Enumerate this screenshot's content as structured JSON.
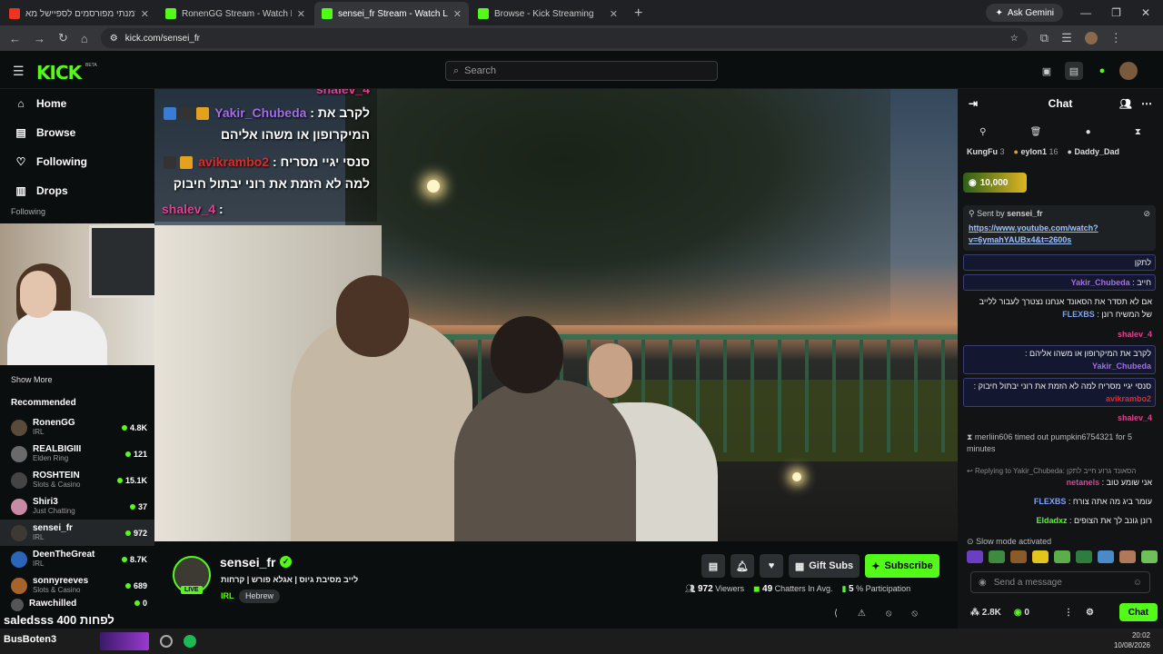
{
  "browser": {
    "tabs": [
      {
        "title": "הזמנתי מפורסמים לספיישל מא",
        "fav_color": "#e32"
      },
      {
        "title": "RonenGG Stream - Watch Live on",
        "fav_color": "#53fc18"
      },
      {
        "title": "sensei_fr Stream - Watch Li",
        "fav_color": "#53fc18"
      },
      {
        "title": "Browse - Kick Streaming",
        "fav_color": "#53fc18"
      }
    ],
    "gemini_label": "Ask Gemini",
    "url": "kick.com/sensei_fr"
  },
  "header": {
    "logo": "KICK",
    "beta": "BETA",
    "search_placeholder": "Search"
  },
  "sidebar": {
    "nav": [
      {
        "label": "Home",
        "icon": "home-icon"
      },
      {
        "label": "Browse",
        "icon": "browse-icon"
      },
      {
        "label": "Following",
        "icon": "heart-icon"
      },
      {
        "label": "Drops",
        "icon": "drops-icon"
      }
    ],
    "following_label": "Following",
    "show_more": "Show More",
    "recommended_title": "Recommended",
    "recommended": [
      {
        "name": "RonenGG",
        "category": "IRL",
        "viewers": "4.8K",
        "color": "#5a4a3a"
      },
      {
        "name": "REALBIGIII",
        "category": "Elden Ring",
        "viewers": "121",
        "color": "#6a6a6a"
      },
      {
        "name": "ROSHTEIN",
        "category": "Slots & Casino",
        "viewers": "15.1K",
        "color": "#444"
      },
      {
        "name": "Shiri3",
        "category": "Just Chatting",
        "viewers": "37",
        "color": "#c98aa5"
      },
      {
        "name": "sensei_fr",
        "category": "IRL",
        "viewers": "972",
        "color": "#3c3a33"
      },
      {
        "name": "DeenTheGreat",
        "category": "IRL",
        "viewers": "8.7K",
        "color": "#2a66b8"
      },
      {
        "name": "sonnyreeves",
        "category": "Slots & Casino",
        "viewers": "689",
        "color": "#a6632a"
      },
      {
        "name": "Rawchilled",
        "category": "",
        "viewers": "0",
        "color": "#555"
      }
    ],
    "big_overlay": "saledsss לפחות 400"
  },
  "video_overlay": {
    "lines": [
      {
        "user": "shalev_4",
        "text": "",
        "cls": "pink"
      },
      {
        "user": "Yakir_Chubeda",
        "text": "לקרב את",
        "cls": ""
      },
      {
        "user": "",
        "text": "המיקרופון או משהו אליהם",
        "cls": ""
      },
      {
        "user": "avikrambo2",
        "text": "סנסי יגיי מסריח",
        "cls": "red"
      },
      {
        "user": "",
        "text": "למה לא הזמת את רוני יבתול חיבוק",
        "cls": ""
      },
      {
        "user": "shalev_4",
        "text": "",
        "cls": "pink"
      }
    ]
  },
  "stream": {
    "channel": "sensei_fr",
    "live": "LIVE",
    "title": "לייב מסיבת גיוס | אגלא פורש | קרחות",
    "category": "IRL",
    "tag": "Hebrew",
    "gift_subs": "Gift Subs",
    "subscribe": "Subscribe",
    "viewers": "972",
    "viewers_label": "Viewers",
    "chatters": "49",
    "chatters_label": "Chatters In Avg.",
    "participation": "5",
    "participation_label": "% Participation"
  },
  "chat": {
    "title": "Chat",
    "gifters": [
      {
        "name": "KungFu",
        "count": "3"
      },
      {
        "name": "eylon1",
        "count": "16"
      },
      {
        "name": "Daddy_Dad",
        "count": ""
      }
    ],
    "kicks_amount": "10,000",
    "pinned_sent_by": "Sent by",
    "pinned_user": "sensei_fr",
    "pinned_link": "https://www.youtube.com/watch?v=6ymahYAUBx4&t=2600s",
    "messages": [
      {
        "user": "",
        "text": "לתקן",
        "ucolor": "#fff",
        "hl": true
      },
      {
        "user": "Yakir_Chubeda",
        "text": "חייב",
        "ucolor": "#a76ce8",
        "hl": true
      },
      {
        "user": "FLEXBS",
        "text": "אם לא תסדר את הסאונד אנחנו נצטרך לעבור ללייב של המשיח רונן",
        "ucolor": "#7ea1ff",
        "hl": false
      },
      {
        "user": "shalev_4",
        "text": "",
        "ucolor": "#d94393",
        "hl": false
      },
      {
        "user": "Yakir_Chubeda",
        "text": "לקרב את המיקרופון או משהו אליהם",
        "ucolor": "#a76ce8",
        "hl": true
      },
      {
        "user": "avikrambo2",
        "text": "סנסי יגיי מסריח למה לא הזמת את רוני יבתול חיבוק",
        "ucolor": "#e02a2a",
        "hl": true
      },
      {
        "user": "shalev_4",
        "text": "",
        "ucolor": "#d94393",
        "hl": false
      }
    ],
    "timeout_text": "merliin606 timed out pumpkin6754321 for 5 minutes",
    "reply_text": "Replying to Yakir_Chubeda: הסאונד גרוע חייב לתקן",
    "messages2": [
      {
        "user": "netanels",
        "text": "אני שומע טוב",
        "ucolor": "#d94393"
      },
      {
        "user": "FLEXBS",
        "text": "עומר ביג מה אתה צורח",
        "ucolor": "#7ea1ff"
      },
      {
        "user": "Eldadxz",
        "text": "רונן גונב לך את הצופים",
        "ucolor": "#53fc18"
      }
    ],
    "slow_mode": "Slow mode activated",
    "input_placeholder": "Send a message",
    "points": "2.8K",
    "kicks": "0",
    "chat_button": "Chat"
  },
  "taskbar": {
    "time": "20:02",
    "date": "10/08/2026",
    "label": "BusBoten3"
  }
}
